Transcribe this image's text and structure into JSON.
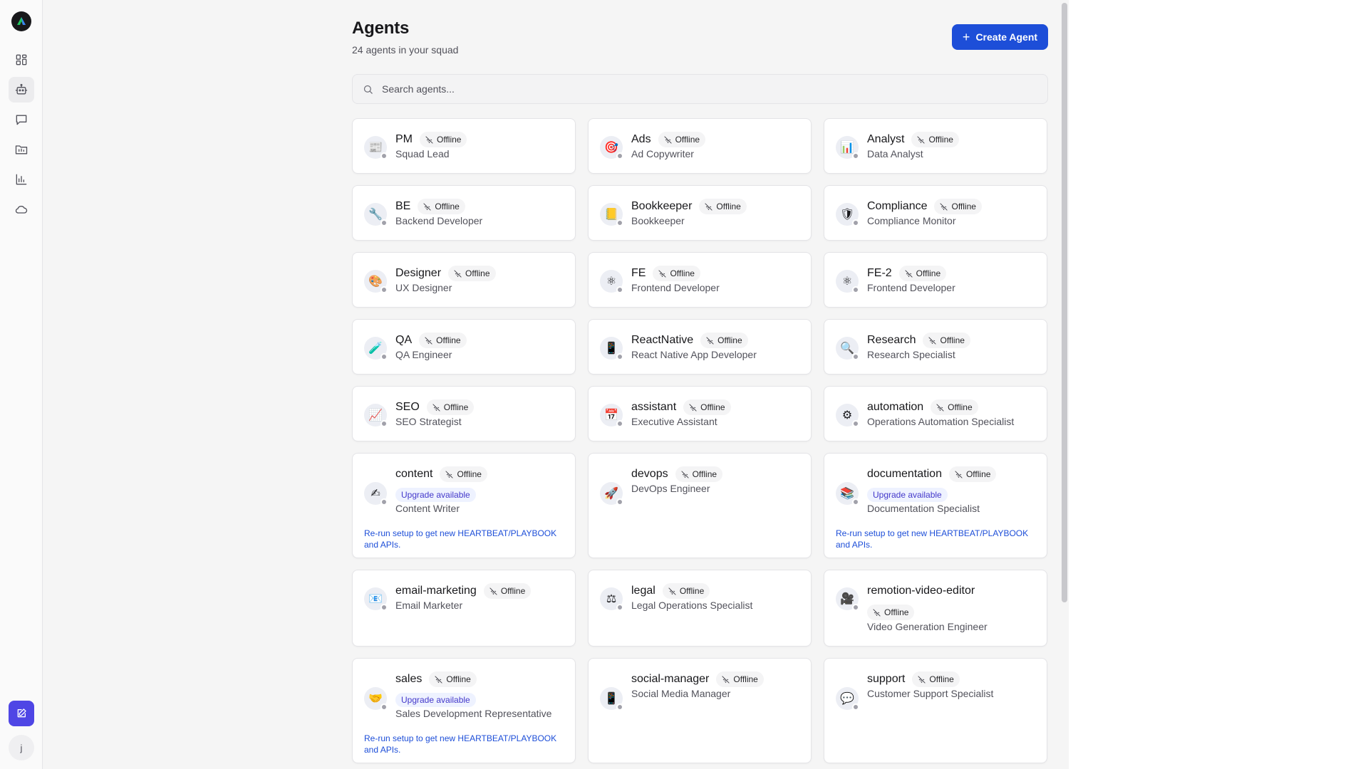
{
  "header": {
    "title": "Agents",
    "subtitle": "24 agents in your squad",
    "create_label": "Create Agent"
  },
  "search": {
    "placeholder": "Search agents..."
  },
  "sidebar": {
    "items": [
      "dashboard-icon",
      "robot-icon",
      "message-icon",
      "folder-icon",
      "chart-icon",
      "cloud-icon"
    ],
    "user_initial": "j"
  },
  "status_label": "Offline",
  "upgrade_label": "Upgrade available",
  "hint_text": "Re-run setup to get new HEARTBEAT/PLAYBOOK and APIs.",
  "agents": [
    {
      "name": "PM",
      "role": "Squad Lead",
      "emoji": "📰"
    },
    {
      "name": "Ads",
      "role": "Ad Copywriter",
      "emoji": "🎯"
    },
    {
      "name": "Analyst",
      "role": "Data Analyst",
      "emoji": "📊"
    },
    {
      "name": "BE",
      "role": "Backend Developer",
      "emoji": "🔧"
    },
    {
      "name": "Bookkeeper",
      "role": "Bookkeeper",
      "emoji": "📒"
    },
    {
      "name": "Compliance",
      "role": "Compliance Monitor",
      "emoji": "🛡"
    },
    {
      "name": "Designer",
      "role": "UX Designer",
      "emoji": "🎨"
    },
    {
      "name": "FE",
      "role": "Frontend Developer",
      "emoji": "⚛"
    },
    {
      "name": "FE-2",
      "role": "Frontend Developer",
      "emoji": "⚛"
    },
    {
      "name": "QA",
      "role": "QA Engineer",
      "emoji": "🧪"
    },
    {
      "name": "ReactNative",
      "role": "React Native App Developer",
      "emoji": "📱"
    },
    {
      "name": "Research",
      "role": "Research Specialist",
      "emoji": "🔍"
    },
    {
      "name": "SEO",
      "role": "SEO Strategist",
      "emoji": "📈"
    },
    {
      "name": "assistant",
      "role": "Executive Assistant",
      "emoji": "📅"
    },
    {
      "name": "automation",
      "role": "Operations Automation Specialist",
      "emoji": "⚙"
    },
    {
      "name": "content",
      "role": "Content Writer",
      "emoji": "✍"
    },
    {
      "name": "devops",
      "role": "DevOps Engineer",
      "emoji": "🚀"
    },
    {
      "name": "documentation",
      "role": "Documentation Specialist",
      "emoji": "📚"
    },
    {
      "name": "email-marketing",
      "role": "Email Marketer",
      "emoji": "📧"
    },
    {
      "name": "legal",
      "role": "Legal Operations Specialist",
      "emoji": "⚖"
    },
    {
      "name": "remotion-video-editor",
      "role": "Video Generation Engineer",
      "emoji": "🎥"
    },
    {
      "name": "sales",
      "role": "Sales Development Representative",
      "emoji": "🤝"
    },
    {
      "name": "social-manager",
      "role": "Social Media Manager",
      "emoji": "📱"
    },
    {
      "name": "support",
      "role": "Customer Support Specialist",
      "emoji": "💬"
    }
  ]
}
